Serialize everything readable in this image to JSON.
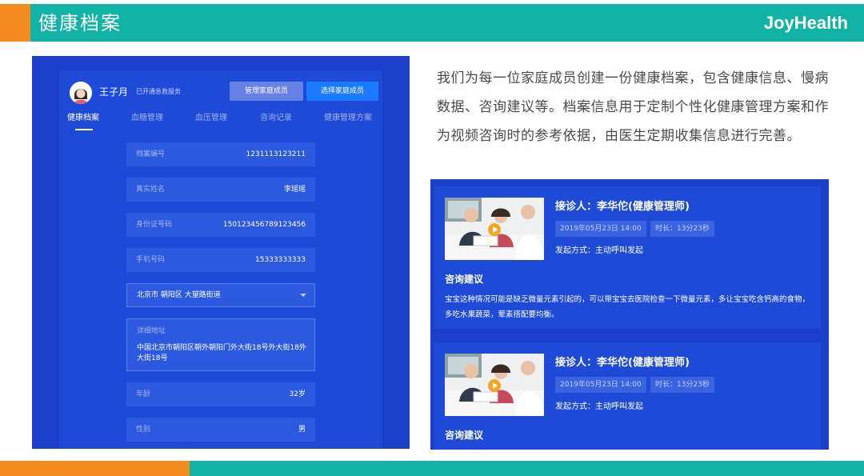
{
  "header": {
    "title": "健康档案",
    "brand": "JoyHealth",
    "colors": {
      "teal": "#12B2A6",
      "orange": "#F58A1F"
    }
  },
  "app": {
    "user": {
      "name": "王子月",
      "status": "已开通急救服务"
    },
    "buttons": {
      "manage": "管理家庭成员",
      "select": "选择家庭成员"
    },
    "tabs": [
      {
        "label": "健康档案",
        "active": true
      },
      {
        "label": "血糖管理"
      },
      {
        "label": "血压管理"
      },
      {
        "label": "咨询记录"
      },
      {
        "label": "健康管理方案"
      }
    ],
    "fields": {
      "record_no": {
        "label": "档案编号",
        "value": "1231113123211"
      },
      "real_name": {
        "label": "真实姓名",
        "value": "李瑶瑶"
      },
      "id_no": {
        "label": "身份证号码",
        "value": "150123456789123456"
      },
      "phone": {
        "label": "手机号码",
        "value": "15333333333"
      },
      "region": {
        "value": "北京市 朝阳区 大望路街道"
      },
      "address": {
        "label": "详细地址",
        "value": "中国北京市朝阳区朝外朝阳门外大街18号外大街18外大街18号"
      },
      "age": {
        "label": "年龄",
        "value": "32岁"
      },
      "gender": {
        "label": "性别",
        "value": "男"
      }
    },
    "colors": {
      "panel": "#1B3FCB",
      "primary_button": "#1A7BFF"
    }
  },
  "description": "我们为每一位家庭成员创建一份健康档案，包含健康信息、慢病数据、咨询建议等。档案信息用于定制个性化健康管理方案和作为视频咨询时的参考依据，由医生定期收集信息进行完善。",
  "consultations": [
    {
      "doctor": "接诊人：李华佗(健康管理师)",
      "date": "2019年05月23日 14:00",
      "duration": "时长：13分23秒",
      "initiated": "发起方式：主动呼叫发起",
      "advice_title": "咨询建议",
      "advice_text": "宝宝这种情况可能是缺乏微量元素引起的，可以带宝宝去医院检查一下微量元素，多让宝宝吃含钙高的食物，多吃水果蔬菜，荤素搭配要均衡。"
    },
    {
      "doctor": "接诊人：李华佗(健康管理师)",
      "date": "2019年05月23日 14:00",
      "duration": "时长：13分23秒",
      "initiated": "发起方式：主动呼叫发起",
      "advice_title": "咨询建议"
    }
  ]
}
